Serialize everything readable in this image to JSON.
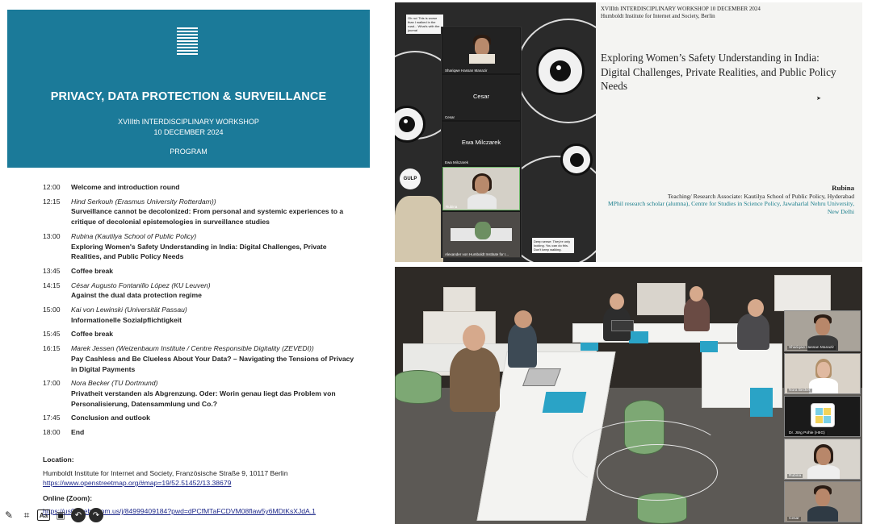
{
  "program": {
    "header": {
      "title": "PRIVACY, DATA PROTECTION & SURVEILLANCE",
      "subtitle": "XVIIIth INTERDISCIPLINARY WORKSHOP",
      "date": "10 DECEMBER 2024",
      "section": "PROGRAM"
    },
    "schedule": [
      {
        "time": "12:00",
        "speaker": "",
        "talk": "Welcome and introduction round"
      },
      {
        "time": "12:15",
        "speaker": "Hind Serkouh (Erasmus University Rotterdam))",
        "talk": "Surveillance cannot be decolonized: From personal and systemic experiences to a critique of decolonial epistemologies in surveillance studies"
      },
      {
        "time": "13:00",
        "speaker": "Rubina (Kautilya School of Public Policy)",
        "talk": "Exploring Women's Safety Understanding in India: Digital Challenges, Private Realities, and Public Policy Needs"
      },
      {
        "time": "13:45",
        "speaker": "",
        "talk": "Coffee break"
      },
      {
        "time": "14:15",
        "speaker": "César Augusto Fontanillo López (KU Leuven)",
        "talk": "Against the dual data protection regime"
      },
      {
        "time": "15:00",
        "speaker": "Kai von Lewinski (Universität Passau)",
        "talk": "Informationelle Sozialpflichtigkeit"
      },
      {
        "time": "15:45",
        "speaker": "",
        "talk": "Coffee break"
      },
      {
        "time": "16:15",
        "speaker": "Marek Jessen (Weizenbaum Institute / Centre Responsible Digitality (ZEVEDI))",
        "talk": "Pay Cashless and Be Clueless About Your Data? – Navigating the Tensions of Privacy in Digital Payments"
      },
      {
        "time": "17:00",
        "speaker": "Nora Becker (TU Dortmund)",
        "talk": "Privatheit verstanden als Abgrenzung. Oder: Worin genau liegt das Problem von Personalisierung, Datensammlung und Co.?"
      },
      {
        "time": "17:45",
        "speaker": "",
        "talk": "Conclusion and outlook"
      },
      {
        "time": "18:00",
        "speaker": "",
        "talk": "End"
      }
    ],
    "location": {
      "label": "Location:",
      "address": "Humboldt Institute for Internet and Society, Französische Straße 9, 10117 Berlin",
      "map_link": "https://www.openstreetmap.org/#map=19/52.51452/13.38679",
      "online_label": "Online (Zoom):",
      "zoom_link": "https://us02web.zoom.us/j/84999409184?pwd=dPCfMTaFCDVM08flaw5y6MDtKsXJdA.1"
    }
  },
  "annotation_toolbar": {
    "icons": [
      "pencil-icon",
      "crop-icon",
      "text-icon",
      "sticker-icon",
      "undo-icon",
      "redo-icon"
    ],
    "text_glyph": "Aa"
  },
  "slide": {
    "header_line1": "XVIIIth INTERDISCIPLINARY WORKSHOP 10 DECEMBER 2024",
    "header_line2": "Humboldt Institute for Internet and Society, Berlin",
    "title": "Exploring Women’s Safety Understanding in India: Digital Challenges, Private Realities, and Public Policy Needs",
    "author": "Rubina",
    "role": "Teaching/ Research Associate: Kautilya School of Public Policy, Hyderabad",
    "affiliation": "MPhil research scholar (alumna), Centre for Studies in Science Policy, Jawaharlal Nehru University, New Delhi",
    "accent": "#1a7e8c"
  },
  "comic": {
    "bubble_top": "Oh no! This is worse than I walked in the road... What's with the journal",
    "gulp": "GULP",
    "bubble_bottom": "Deep sense: They're only looking. You can do this. Don't keep walking."
  },
  "zoom_strip": {
    "participants": [
      {
        "name": "Shariqwe Hassan Manazir",
        "label": ""
      },
      {
        "name": "Cesar",
        "label": "Cesar"
      },
      {
        "name": "Ewa Milczarek",
        "label": "Ewa Milczarek"
      },
      {
        "name": "Rubina",
        "label": ""
      },
      {
        "name": "Alexander von Humboldt Institute for I...",
        "label": ""
      }
    ]
  },
  "room_tiles": {
    "participants": [
      {
        "name": "Shariqwe Hassan Manazir"
      },
      {
        "name": "Nora Becker"
      },
      {
        "name": "Dr. Jörg Pohle (HIIG)"
      },
      {
        "name": "Rubina"
      },
      {
        "name": "Cesar"
      }
    ]
  },
  "colors": {
    "header_blue": "#1b7a99",
    "link_blue": "#1f2a8a",
    "tablecloth": "#2aa3c6"
  }
}
